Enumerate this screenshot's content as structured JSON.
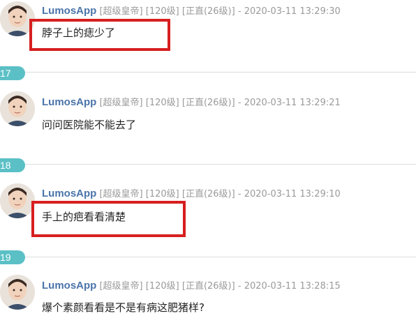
{
  "posts": [
    {
      "username": "LumosApp",
      "tag_rank": "[超级皇帝]",
      "tag_level": "[120级]",
      "tag_title": "[正直(26级)]",
      "separator": "-",
      "timestamp": "2020-03-11 13:29:30",
      "content": "脖子上的痣少了",
      "highlighted": true
    },
    {
      "floor": "17",
      "username": "LumosApp",
      "tag_rank": "[超级皇帝]",
      "tag_level": "[120级]",
      "tag_title": "[正直(26级)]",
      "separator": "-",
      "timestamp": "2020-03-11 13:29:21",
      "content": "问问医院能不能去了",
      "highlighted": false
    },
    {
      "floor": "18",
      "username": "LumosApp",
      "tag_rank": "[超级皇帝]",
      "tag_level": "[120级]",
      "tag_title": "[正直(26级)]",
      "separator": "-",
      "timestamp": "2020-03-11 13:29:10",
      "content": "手上的疤看看清楚",
      "highlighted": true
    },
    {
      "floor": "19",
      "username": "LumosApp",
      "tag_rank": "[超级皇帝]",
      "tag_level": "[120级]",
      "tag_title": "[正直(26级)]",
      "separator": "-",
      "timestamp": "2020-03-11 13:28:15",
      "content": "爆个素颜看看是不是有病这肥猪样?",
      "highlighted": false
    }
  ],
  "colors": {
    "username": "#4a74a9",
    "tag_gray": "#9a9a9a",
    "floor_badge": "#5bc0c6",
    "highlight_red": "#d71f1f",
    "divider": "#dcdcdc"
  },
  "icons": {
    "avatar": "user-avatar"
  }
}
